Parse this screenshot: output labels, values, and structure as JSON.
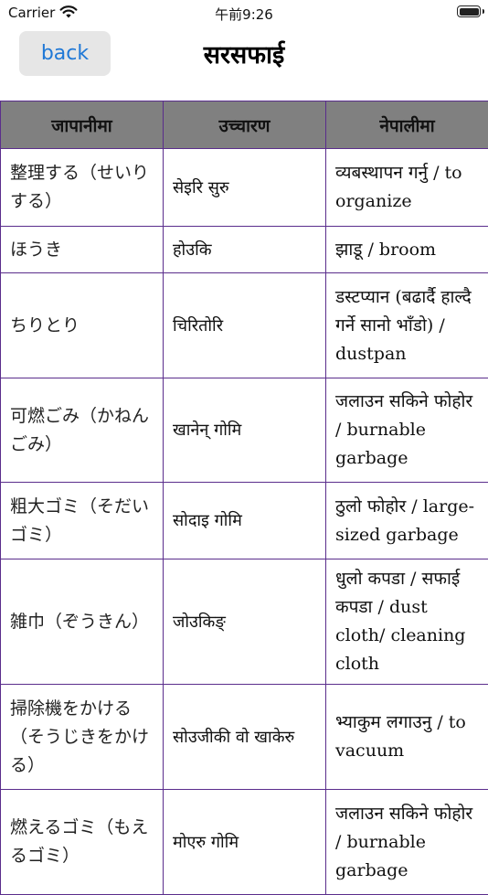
{
  "status_bar": {
    "carrier": "Carrier",
    "time": "午前9:26"
  },
  "nav": {
    "back_label": "back",
    "title": "सरसफाई"
  },
  "table": {
    "headers": [
      "जापानीमा",
      "उच्चारण",
      "नेपालीमा"
    ],
    "rows": [
      {
        "japanese": "整理する（せいりする）",
        "pronunciation": "सेइरि सुरु",
        "nepali": "व्यबस्थापन गर्नु / to organize"
      },
      {
        "japanese": "ほうき",
        "pronunciation": "होउकि",
        "nepali": "झाडू / broom"
      },
      {
        "japanese": "ちりとり",
        "pronunciation": "चिरितोरि",
        "nepali": "डस्टप्यान (बढार्दै हाल्दै गर्ने सानो भाँडो) / dustpan"
      },
      {
        "japanese": "可燃ごみ（かねんごみ）",
        "pronunciation": "खानेन् गोमि",
        "nepali": "जलाउन सकिने फोहोर / burnable garbage"
      },
      {
        "japanese": "粗大ゴミ（そだいゴミ）",
        "pronunciation": "सोदाइ गोमि",
        "nepali": "ठुलो फोहोर / large-sized garbage"
      },
      {
        "japanese": "雑巾（ぞうきん）",
        "pronunciation": "जोउकिङ्",
        "nepali": "धुलो कपडा / सफाई कपडा / dust cloth/ cleaning cloth"
      },
      {
        "japanese": "掃除機をかける（そうじきをかける）",
        "pronunciation": "सोउजीकी वो खाकेरु",
        "nepali": "भ्याकुम लगाउनु / to vacuum"
      },
      {
        "japanese": "燃えるゴミ（もえるゴミ）",
        "pronunciation": "मोएरु गोमि",
        "nepali": "जलाउन सकिने फोहोर / burnable garbage"
      }
    ]
  },
  "colors": {
    "accent": "#1f78d6",
    "table_border": "#5a2d8c",
    "header_background": "#808080"
  },
  "icons": [
    "wifi-icon",
    "battery-icon"
  ]
}
